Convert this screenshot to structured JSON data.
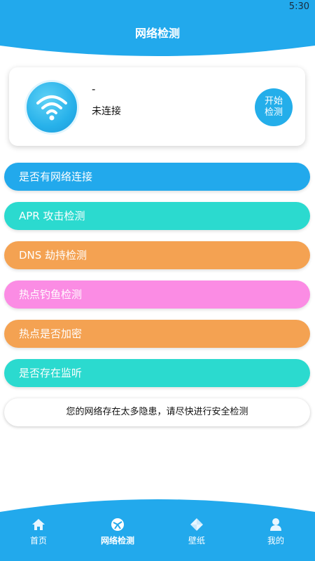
{
  "status_bar": {
    "time": "5:30"
  },
  "header": {
    "title": "网络检测"
  },
  "status_card": {
    "network_name": "-",
    "connection_state": "未连接",
    "start_button": [
      "开始",
      "检测"
    ],
    "icon": "wifi-icon"
  },
  "checks": [
    {
      "label": "是否有网络连接",
      "color": "#22a9ec"
    },
    {
      "label": "APR 攻击检测",
      "color": "#2bdacf"
    },
    {
      "label": "DNS 劫持检测",
      "color": "#f4a252"
    },
    {
      "label": "热点钓鱼检测",
      "color": "#fb8ce4"
    },
    {
      "label": "热点是否加密",
      "color": "#f4a252"
    },
    {
      "label": "是否存在监听",
      "color": "#2bdacf"
    }
  ],
  "notice": {
    "text": "您的网络存在太多隐患，请尽快进行安全检测"
  },
  "bottom_nav": {
    "items": [
      {
        "label": "首页",
        "icon": "home-icon"
      },
      {
        "label": "网络检测",
        "icon": "network-check-icon",
        "active": true
      },
      {
        "label": "壁纸",
        "icon": "wallpaper-icon"
      },
      {
        "label": "我的",
        "icon": "profile-icon"
      }
    ]
  },
  "colors": {
    "primary": "#22a9ec",
    "white": "#ffffff"
  }
}
